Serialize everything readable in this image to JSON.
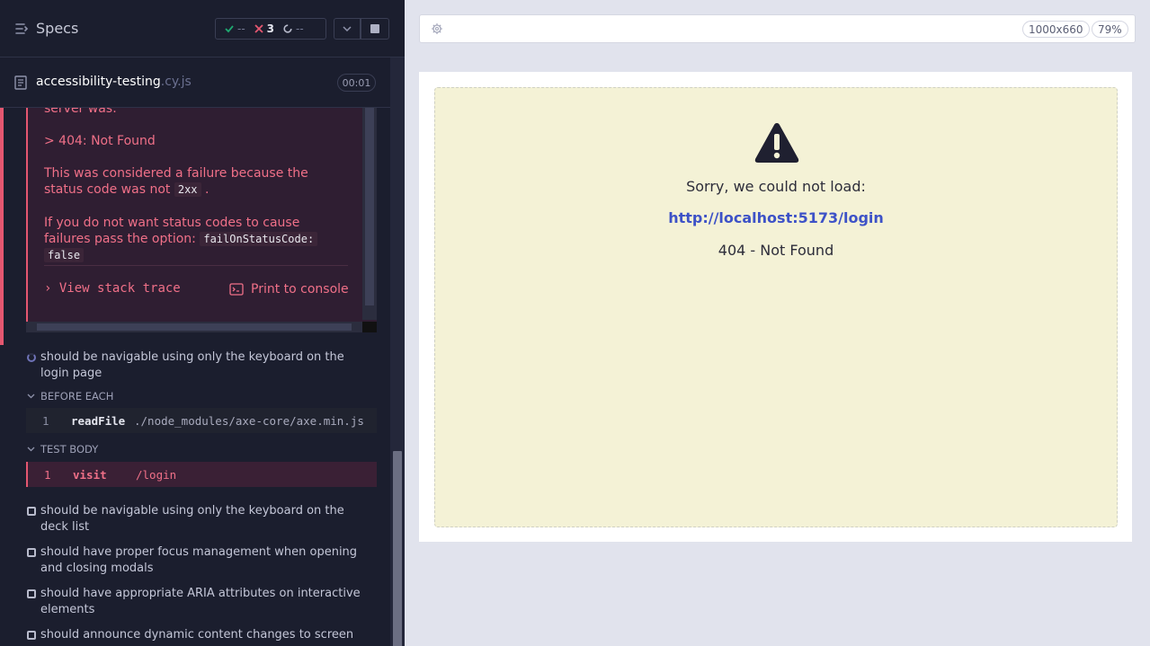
{
  "header": {
    "title": "Specs",
    "stats": {
      "passed": "--",
      "failed": "3",
      "pending": "--"
    }
  },
  "spec_file": {
    "name": "accessibility-testing",
    "ext": ".cy.js",
    "duration": "00:01"
  },
  "error": {
    "line_top": "server was:",
    "status_line": "> 404: Not Found",
    "failure_text": "This was considered a failure because the status code was not",
    "code_2xx": "2xx",
    "period": ".",
    "option_text": "If you do not want status codes to cause failures pass the option:",
    "option_code_1": "failOnStatusCode:",
    "option_code_2": "false",
    "view_stack_trace": "View stack trace",
    "print_to_console": "Print to console"
  },
  "tests": [
    {
      "title": "should be navigable using only the keyboard on the login page",
      "state": "running"
    },
    {
      "title": "should be navigable using only the keyboard on the deck list",
      "state": "pending"
    },
    {
      "title": "should have proper focus management when opening and closing modals",
      "state": "pending"
    },
    {
      "title": "should have appropriate ARIA attributes on interactive elements",
      "state": "pending"
    },
    {
      "title": "should announce dynamic content changes to screen",
      "state": "pending"
    }
  ],
  "hooks": {
    "before_each": {
      "label": "BEFORE EACH",
      "num": "1",
      "command": "readFile",
      "arg": "./node_modules/axe-core/axe.min.js"
    },
    "test_body": {
      "label": "TEST BODY",
      "num": "1",
      "command": "visit",
      "arg": "/login"
    }
  },
  "aut": {
    "viewport": "1000x660",
    "zoom": "79%",
    "error_page": {
      "sorry": "Sorry, we could not load:",
      "url": "http://localhost:5173/login",
      "status": "404 - Not Found"
    }
  },
  "colors": {
    "fail": "#e45770",
    "pass": "#1fa971",
    "link": "#3d52c7",
    "panel": "#1b1e2e"
  }
}
